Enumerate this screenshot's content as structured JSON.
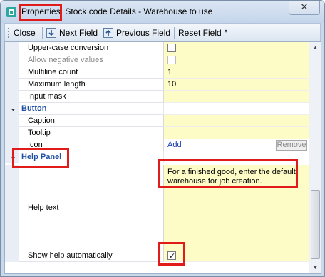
{
  "window": {
    "title_prefix": "Properties:",
    "title_rest": " Stock code Details - Warehouse to use",
    "close_label": "✕"
  },
  "toolbar": {
    "close_label": "Close",
    "next_field_label": "Next Field",
    "previous_field_label": "Previous Field",
    "reset_field_label": "Reset Field"
  },
  "rows": {
    "uppercase": {
      "label": "Upper-case conversion",
      "checked": false
    },
    "allow_negative": {
      "label": "Allow negative values",
      "checked": false
    },
    "multiline": {
      "label": "Multiline count",
      "value": "1"
    },
    "maxlength": {
      "label": "Maximum length",
      "value": "10"
    },
    "input_mask": {
      "label": "Input mask",
      "value": ""
    },
    "button_category": {
      "label": "Button"
    },
    "caption": {
      "label": "Caption",
      "value": ""
    },
    "tooltip": {
      "label": "Tooltip",
      "value": ""
    },
    "icon": {
      "label": "Icon",
      "add_label": "Add",
      "remove_label": "Remove"
    },
    "help_category": {
      "label": "Help Panel"
    },
    "help_text": {
      "label": "Help text",
      "value": "For a finished good, enter the default warehouse for job creation."
    },
    "show_help": {
      "label": "Show help automatically",
      "checked": true
    }
  },
  "colors": {
    "highlight": "#e11a1a",
    "value_bg": "#fefcc6",
    "category_text": "#1e4fa3"
  }
}
